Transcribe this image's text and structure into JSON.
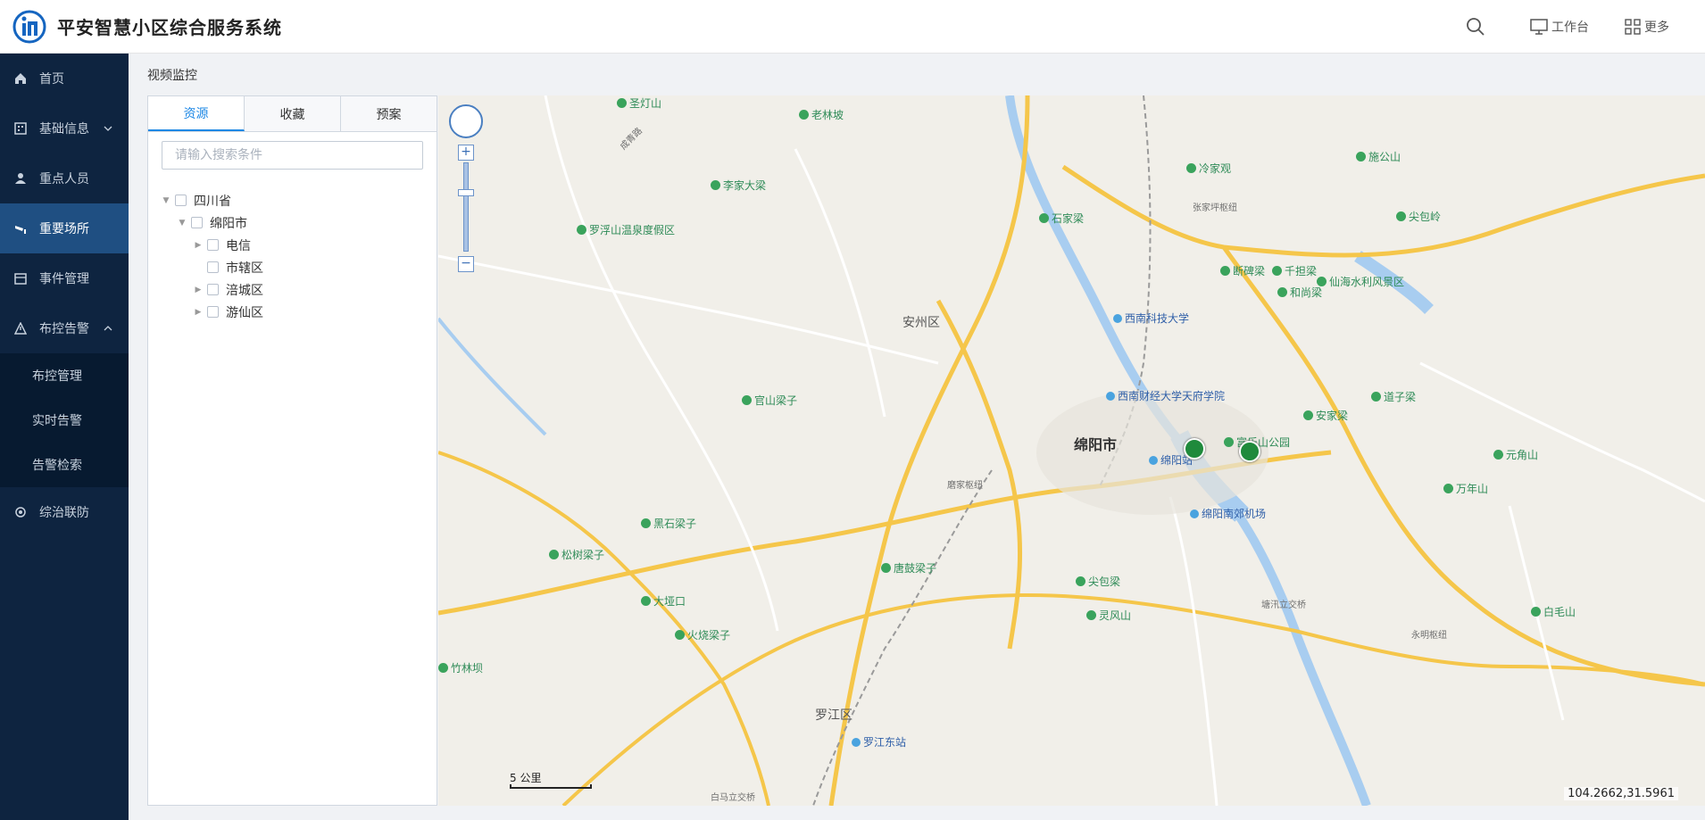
{
  "header": {
    "title": "平安智慧小区综合服务系统",
    "workbench_label": "工作台",
    "more_label": "更多"
  },
  "sidebar": {
    "items": [
      {
        "label": "首页"
      },
      {
        "label": "基础信息"
      },
      {
        "label": "重点人员"
      },
      {
        "label": "重要场所"
      },
      {
        "label": "事件管理"
      },
      {
        "label": "布控告警"
      },
      {
        "label": "综治联防"
      }
    ],
    "sub_items": [
      {
        "label": "布控管理"
      },
      {
        "label": "实时告警"
      },
      {
        "label": "告警检索"
      }
    ]
  },
  "breadcrumb": "视频监控",
  "tree_panel": {
    "tabs": [
      "资源",
      "收藏",
      "预案"
    ],
    "search_placeholder": "请输入搜索条件",
    "nodes": [
      {
        "label": "四川省"
      },
      {
        "label": "绵阳市"
      },
      {
        "label": "电信"
      },
      {
        "label": "市辖区"
      },
      {
        "label": "涪城区"
      },
      {
        "label": "游仙区"
      }
    ]
  },
  "map": {
    "city": "绵阳市",
    "district_labels": [
      "安州区",
      "罗江区"
    ],
    "place_labels": [
      "磨家枢纽",
      "张家坪枢纽",
      "塘汛立交桥",
      "永明枢纽",
      "绵阳站",
      "绵阳南郊机场",
      "西南科技大学",
      "西南财经大学天府学院",
      "罗江东站",
      "富乐山公园",
      "成青路",
      "白马立交桥"
    ],
    "green_labels": [
      "圣灯山",
      "老林坡",
      "李家大梁",
      "罗浮山温泉度假区",
      "冷家观",
      "石家梁",
      "断碑梁",
      "千担梁",
      "和尚梁",
      "仙海水利风景区",
      "尖包岭",
      "施公山",
      "官山梁子",
      "安家梁",
      "道子梁",
      "元角山",
      "万年山",
      "黑石梁子",
      "松树梁子",
      "大垭口",
      "唐鼓梁子",
      "尖包梁",
      "灵风山",
      "火烧梁子",
      "白毛山",
      "竹林坝"
    ],
    "scale_label": "5 公里",
    "coordinates": "104.2662,31.5961"
  },
  "colors": {
    "sidebar_bg": "#0e2440",
    "sidebar_active": "#1f4f82",
    "accent": "#1e88e5"
  }
}
